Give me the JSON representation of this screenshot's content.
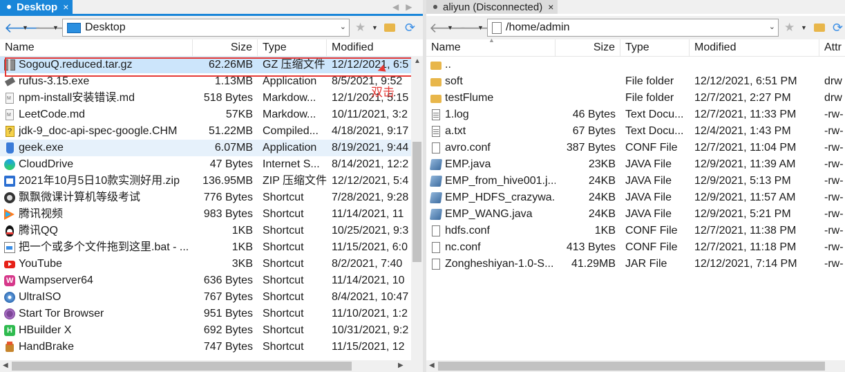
{
  "left": {
    "tab": {
      "label": "Desktop",
      "close": "×"
    },
    "address": "Desktop",
    "columns": {
      "name": "Name",
      "size": "Size",
      "type": "Type",
      "modified": "Modified"
    },
    "files": [
      {
        "name": "SogouQ.reduced.tar.gz",
        "size": "62.26MB",
        "type": "GZ 压缩文件",
        "modified": "12/12/2021, 6:5",
        "icon": "archive-icon",
        "state": "selected"
      },
      {
        "name": "rufus-3.15.exe",
        "size": "1.13MB",
        "type": "Application",
        "modified": "8/5/2021, 9:52",
        "icon": "usb-drive-icon"
      },
      {
        "name": "npm-install安装错误.md",
        "size": "518 Bytes",
        "type": "Markdow...",
        "modified": "12/1/2021, 5:15",
        "icon": "markdown-file-icon"
      },
      {
        "name": "LeetCode.md",
        "size": "57KB",
        "type": "Markdow...",
        "modified": "10/11/2021, 3:2",
        "icon": "markdown-file-icon"
      },
      {
        "name": "jdk-9_doc-api-spec-google.CHM",
        "size": "51.22MB",
        "type": "Compiled...",
        "modified": "4/18/2021, 9:17",
        "icon": "help-file-icon"
      },
      {
        "name": "geek.exe",
        "size": "6.07MB",
        "type": "Application",
        "modified": "8/19/2021, 9:44",
        "icon": "trash-app-icon",
        "state": "hover"
      },
      {
        "name": "CloudDrive",
        "size": "47 Bytes",
        "type": "Internet S...",
        "modified": "8/14/2021, 12:2",
        "icon": "edge-link-icon"
      },
      {
        "name": "2021年10月5日10款实测好用.zip",
        "size": "136.95MB",
        "type": "ZIP 压缩文件",
        "modified": "12/12/2021, 5:4",
        "icon": "zip-icon"
      },
      {
        "name": "飘飘微课计算机等级考试",
        "size": "776 Bytes",
        "type": "Shortcut",
        "modified": "7/28/2021, 9:28",
        "icon": "app-shortcut-icon"
      },
      {
        "name": "腾讯视频",
        "size": "983 Bytes",
        "type": "Shortcut",
        "modified": "11/14/2021, 11",
        "icon": "tencent-video-icon"
      },
      {
        "name": "腾讯QQ",
        "size": "1KB",
        "type": "Shortcut",
        "modified": "10/25/2021, 9:3",
        "icon": "qq-icon"
      },
      {
        "name": "把一个或多个文件拖到这里.bat - ...",
        "size": "1KB",
        "type": "Shortcut",
        "modified": "11/15/2021, 6:0",
        "icon": "batch-shortcut-icon"
      },
      {
        "name": "YouTube",
        "size": "3KB",
        "type": "Shortcut",
        "modified": "8/2/2021, 7:40",
        "icon": "youtube-icon"
      },
      {
        "name": "Wampserver64",
        "size": "636 Bytes",
        "type": "Shortcut",
        "modified": "11/14/2021, 10",
        "icon": "wamp-icon"
      },
      {
        "name": "UltraISO",
        "size": "767 Bytes",
        "type": "Shortcut",
        "modified": "8/4/2021, 10:47",
        "icon": "disc-icon"
      },
      {
        "name": "Start Tor Browser",
        "size": "951 Bytes",
        "type": "Shortcut",
        "modified": "11/10/2021, 1:2",
        "icon": "tor-icon"
      },
      {
        "name": "HBuilder X",
        "size": "692 Bytes",
        "type": "Shortcut",
        "modified": "10/31/2021, 9:2",
        "icon": "hbuilder-icon"
      },
      {
        "name": "HandBrake",
        "size": "747 Bytes",
        "type": "Shortcut",
        "modified": "11/15/2021, 12",
        "icon": "handbrake-icon"
      }
    ],
    "annotation": "双击"
  },
  "right": {
    "tab": {
      "label": "aliyun (Disconnected)",
      "close": "×"
    },
    "address": "/home/admin",
    "columns": {
      "name": "Name",
      "size": "Size",
      "type": "Type",
      "modified": "Modified",
      "attr": "Attr"
    },
    "files": [
      {
        "name": "..",
        "size": "",
        "type": "",
        "modified": "",
        "attr": "",
        "icon": "folder-icon"
      },
      {
        "name": "soft",
        "size": "",
        "type": "File folder",
        "modified": "12/12/2021, 6:51 PM",
        "attr": "drw",
        "icon": "folder-icon"
      },
      {
        "name": "testFlume",
        "size": "",
        "type": "File folder",
        "modified": "12/7/2021, 2:27 PM",
        "attr": "drw",
        "icon": "folder-icon"
      },
      {
        "name": "1.log",
        "size": "46 Bytes",
        "type": "Text Docu...",
        "modified": "12/7/2021, 11:33 PM",
        "attr": "-rw-",
        "icon": "text-file-icon"
      },
      {
        "name": "a.txt",
        "size": "67 Bytes",
        "type": "Text Docu...",
        "modified": "12/4/2021, 1:43 PM",
        "attr": "-rw-",
        "icon": "text-file-icon"
      },
      {
        "name": "avro.conf",
        "size": "387 Bytes",
        "type": "CONF File",
        "modified": "12/7/2021, 11:04 PM",
        "attr": "-rw-",
        "icon": "blank-file-icon"
      },
      {
        "name": "EMP.java",
        "size": "23KB",
        "type": "JAVA File",
        "modified": "12/9/2021, 11:39 AM",
        "attr": "-rw-",
        "icon": "java-file-icon"
      },
      {
        "name": "EMP_from_hive001.j...",
        "size": "24KB",
        "type": "JAVA File",
        "modified": "12/9/2021, 5:13 PM",
        "attr": "-rw-",
        "icon": "java-file-icon"
      },
      {
        "name": "EMP_HDFS_crazywa...",
        "size": "24KB",
        "type": "JAVA File",
        "modified": "12/9/2021, 11:57 AM",
        "attr": "-rw-",
        "icon": "java-file-icon"
      },
      {
        "name": "EMP_WANG.java",
        "size": "24KB",
        "type": "JAVA File",
        "modified": "12/9/2021, 5:21 PM",
        "attr": "-rw-",
        "icon": "java-file-icon"
      },
      {
        "name": "hdfs.conf",
        "size": "1KB",
        "type": "CONF File",
        "modified": "12/7/2021, 11:38 PM",
        "attr": "-rw-",
        "icon": "blank-file-icon"
      },
      {
        "name": "nc.conf",
        "size": "413 Bytes",
        "type": "CONF File",
        "modified": "12/7/2021, 11:18 PM",
        "attr": "-rw-",
        "icon": "blank-file-icon"
      },
      {
        "name": "Zongheshiyan-1.0-S...",
        "size": "41.29MB",
        "type": "JAR File",
        "modified": "12/12/2021, 7:14 PM",
        "attr": "-rw-",
        "icon": "blank-file-icon"
      }
    ]
  },
  "colors": {
    "accent": "#1a86d9",
    "selection": "#cce5fb",
    "annotation": "#e53935",
    "folder": "#e8b64a"
  }
}
